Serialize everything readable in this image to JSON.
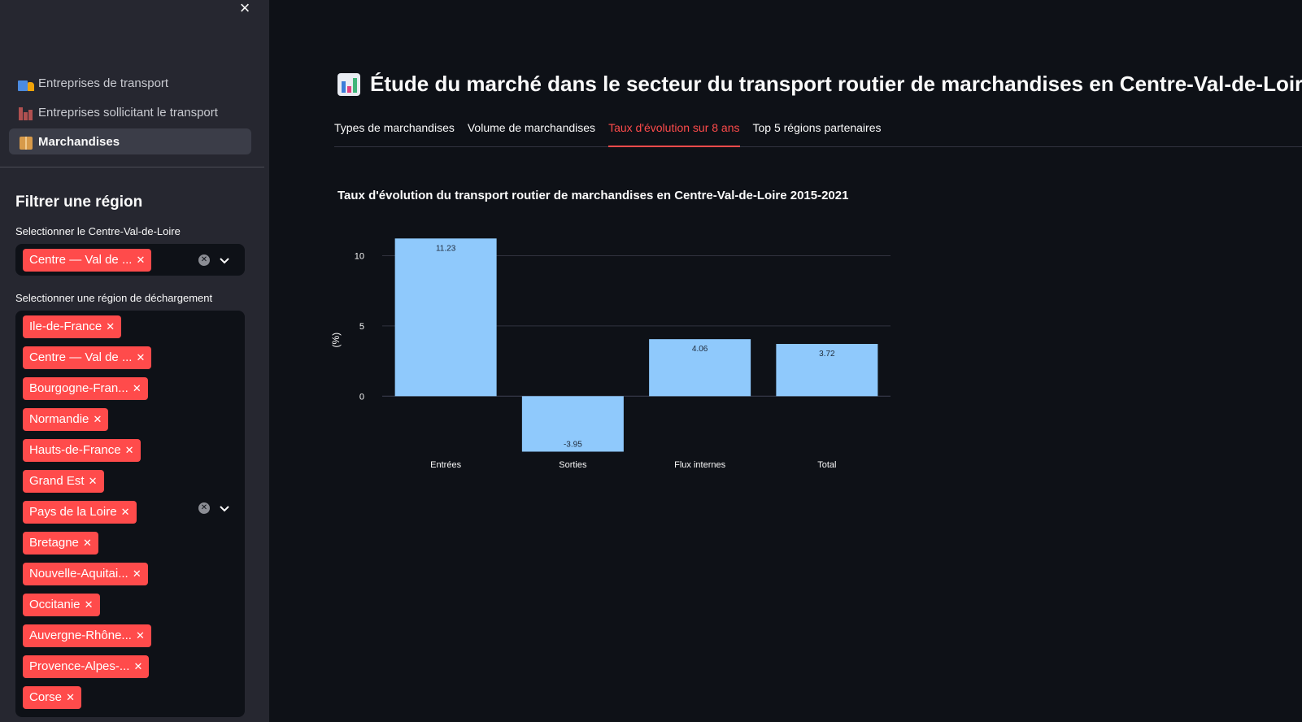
{
  "sidebar": {
    "close_label": "×",
    "nav": [
      {
        "label": "Entreprises de transport",
        "icon": "truck-icon",
        "active": false
      },
      {
        "label": "Entreprises sollicitant le transport",
        "icon": "factory-icon",
        "active": false
      },
      {
        "label": "Marchandises",
        "icon": "package-icon",
        "active": true
      }
    ],
    "filter_title": "Filtrer une région",
    "select1": {
      "label": "Selectionner le Centre-Val-de-Loire",
      "tags": [
        "Centre — Val de ..."
      ]
    },
    "select2": {
      "label": "Selectionner une région de déchargement",
      "tags": [
        "Ile-de-France",
        "Centre — Val de ...",
        "Bourgogne-Fran...",
        "Normandie",
        "Hauts-de-France",
        "Grand Est",
        "Pays de la Loire",
        "Bretagne",
        "Nouvelle-Aquitai...",
        "Occitanie",
        "Auvergne-Rhône...",
        "Provence-Alpes-...",
        "Corse"
      ]
    }
  },
  "header": {
    "title": "Étude du marché dans le secteur du transport routier de marchandises en Centre-Val-de-Loire",
    "icon": "bar-chart-icon"
  },
  "tabs": [
    {
      "label": "Types de marchandises",
      "active": false
    },
    {
      "label": "Volume de marchandises",
      "active": false
    },
    {
      "label": "Taux d'évolution sur 8 ans",
      "active": true
    },
    {
      "label": "Top 5 régions partenaires",
      "active": false
    }
  ],
  "colors": {
    "accent": "#ff4b4b",
    "bar": "#8fc9fc"
  },
  "chart_data": {
    "type": "bar",
    "title": "Taux d'évolution du transport routier de marchandises en Centre-Val-de-Loire 2015-2021",
    "ylabel": "(%)",
    "xlabel": "",
    "categories": [
      "Entrées",
      "Sorties",
      "Flux internes",
      "Total"
    ],
    "values": [
      11.23,
      -3.95,
      4.06,
      3.72
    ],
    "value_labels": [
      "11.23",
      "-3.95",
      "4.06",
      "3.72"
    ],
    "yticks": [
      0,
      5,
      10
    ],
    "ylim": [
      -4.5,
      12
    ],
    "grid": true
  }
}
